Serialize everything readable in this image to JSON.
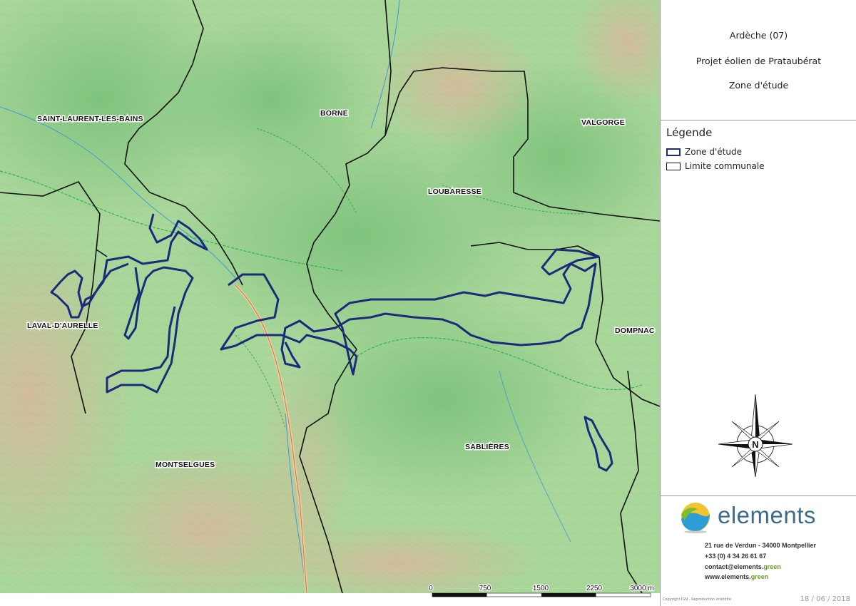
{
  "title": {
    "department": "Ardèche (07)",
    "project": "Projet éolien de Prataubérat",
    "subject": "Zone d'étude"
  },
  "legend": {
    "heading": "Légende",
    "items": [
      {
        "label": "Zone d'étude",
        "stroke": "#1a2b7a"
      },
      {
        "label": "Limite communale",
        "stroke": "#111111"
      }
    ]
  },
  "map": {
    "communes": [
      {
        "id": "saint-laurent-les-bains",
        "name": "SAINT-LAURENT-LES-BAINS"
      },
      {
        "id": "borne",
        "name": "BORNE"
      },
      {
        "id": "loubaresse",
        "name": "LOUBARESSE"
      },
      {
        "id": "valgorge",
        "name": "VALGORGE"
      },
      {
        "id": "laval-d-aurelle",
        "name": "LAVAL-D'AURELLE"
      },
      {
        "id": "dompnac",
        "name": "DOMPNAC"
      },
      {
        "id": "montselgues",
        "name": "MONTSELGUES"
      },
      {
        "id": "sablieres",
        "name": "SABLIÈRES"
      }
    ],
    "scale_labels": [
      "0",
      "750",
      "1500",
      "2250",
      "3000 m"
    ],
    "compass_letter": "N",
    "colors": {
      "study_zone": "#1a2b7a",
      "commune_limit": "#111111",
      "forest": "#8fcf8a",
      "relief": "#c7a98a"
    }
  },
  "company": {
    "name": "elements",
    "address": "21 rue de Verdun - 34000 Montpellier",
    "phone": "+33 (0) 4 34 26 61 67",
    "email_prefix": "contact@elements.",
    "email_suffix": "green",
    "web_prefix": "www.elements.",
    "web_suffix": "green"
  },
  "footer": {
    "copyright": "Copyright IGN - Reproduction interdite",
    "date": "18 / 06 / 2018"
  }
}
